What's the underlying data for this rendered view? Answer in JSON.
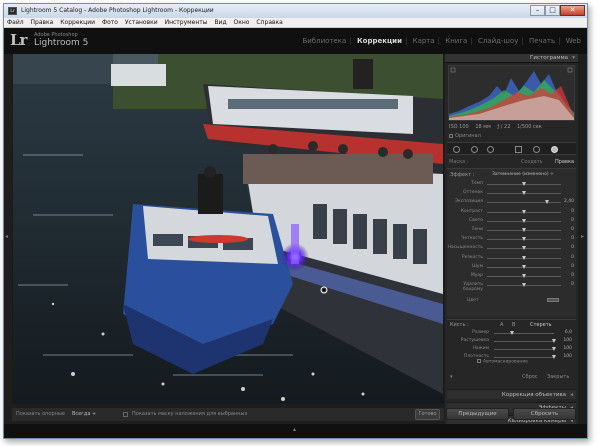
{
  "window": {
    "title": "Lightroom 5 Catalog - Adobe Photoshop Lightroom - Коррекции",
    "app_icon": "Lr",
    "controls": {
      "minimize": "–",
      "maximize": "□",
      "close": "✕"
    }
  },
  "menu": [
    "Файл",
    "Правка",
    "Коррекции",
    "Фото",
    "Установки",
    "Инструменты",
    "Вид",
    "Окно",
    "Справка"
  ],
  "identity": {
    "logo": "Lr",
    "product_line1": "Adobe Photoshop",
    "product_line2": "Lightroom 5"
  },
  "modules": [
    {
      "label": "Библиотека",
      "active": false
    },
    {
      "label": "Коррекции",
      "active": true
    },
    {
      "label": "Карта",
      "active": false
    },
    {
      "label": "Книга",
      "active": false
    },
    {
      "label": "Слайд-шоу",
      "active": false
    },
    {
      "label": "Печать",
      "active": false
    },
    {
      "label": "Web",
      "active": false
    }
  ],
  "histogram": {
    "header": "Гистограмма",
    "iso": "ISO 100",
    "focal": "18 мм",
    "aperture": "ƒ / 22",
    "shutter": "1/500 сек",
    "original_photo": "Оригинал"
  },
  "mask_tabs": {
    "mask": "Маска :",
    "new": "Создать",
    "edit": "Правка"
  },
  "adjust": {
    "effect_label": "Эффект :",
    "effect_value": "Затемнение (изменено) ÷",
    "sliders": [
      {
        "label": "Темп",
        "value": "",
        "pos": 0.5
      },
      {
        "label": "Оттенок",
        "value": "",
        "pos": 0.5
      },
      {
        "label": "Экспозиция",
        "value": "2,40",
        "pos": 0.82
      },
      {
        "label": "Контраст",
        "value": "0",
        "pos": 0.5
      },
      {
        "label": "Свето",
        "value": "0",
        "pos": 0.5
      },
      {
        "label": "Тени",
        "value": "0",
        "pos": 0.5
      },
      {
        "label": "Четкость",
        "value": "0",
        "pos": 0.5
      },
      {
        "label": "Насыщенность",
        "value": "0",
        "pos": 0.5
      },
      {
        "label": "Резкость",
        "value": "0",
        "pos": 0.5
      },
      {
        "label": "Шум",
        "value": "0",
        "pos": 0.5
      },
      {
        "label": "Муар",
        "value": "0",
        "pos": 0.5
      },
      {
        "label": "Удалить бахрому",
        "value": "0",
        "pos": 0.5
      }
    ],
    "color_label": "Цвет"
  },
  "brush": {
    "header_label": "Кисть :",
    "a": "A",
    "b": "B",
    "erase": "Стереть",
    "sliders": [
      {
        "label": "Размер",
        "value": "6,0",
        "pos": 0.3
      },
      {
        "label": "Растушевка",
        "value": "100",
        "pos": 1.0
      },
      {
        "label": "Нажим",
        "value": "100",
        "pos": 1.0
      },
      {
        "label": "Плотность",
        "value": "100",
        "pos": 1.0
      }
    ],
    "automask": "Автомаскирование",
    "reset": "Сброс",
    "close": "Закрыть"
  },
  "collapsed_panels": [
    "Коррекция объектива",
    "Эффекты",
    "Калибровка камеры"
  ],
  "buttons": {
    "previous": "Предыдущие",
    "reset": "Сбросить"
  },
  "toolbar": {
    "show_pins": "Показать опорные",
    "always": "Всегда ÷",
    "show_overlay": "Показать маску наложения для выбранных",
    "done": "Готово"
  }
}
